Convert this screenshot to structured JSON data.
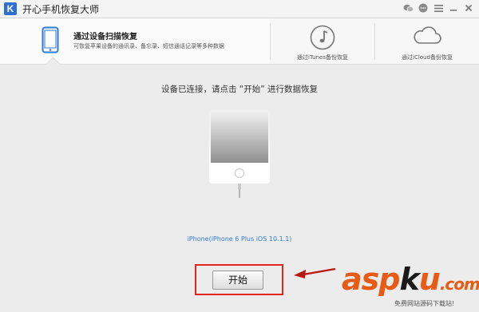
{
  "app": {
    "title": "开心手机恢复大师",
    "logo_text": "K"
  },
  "tabs": [
    {
      "title": "通过设备扫描恢复",
      "subtitle": "可恢复苹果设备的通讯录、备忘录、短信通话记录等多种数据",
      "icon": "phone-icon",
      "active": true
    },
    {
      "label": "通过iTunes备份恢复",
      "icon": "music-note-icon",
      "active": false
    },
    {
      "label": "通过iCloud备份恢复",
      "icon": "cloud-icon",
      "active": false
    }
  ],
  "main": {
    "message": "设备已连接，请点击 “开始” 进行数据恢复",
    "device_label": "iPhone(iPhone 6 Plus iOS 10.1.1)",
    "start_label": "开始"
  },
  "colors": {
    "accent": "#2f7ad6",
    "highlight": "#e2251f"
  },
  "watermark": {
    "brand_a": "asp",
    "brand_k": "k",
    "brand_u": "u",
    "tld": ".com",
    "subtitle": "免费网站源码下载站!"
  }
}
